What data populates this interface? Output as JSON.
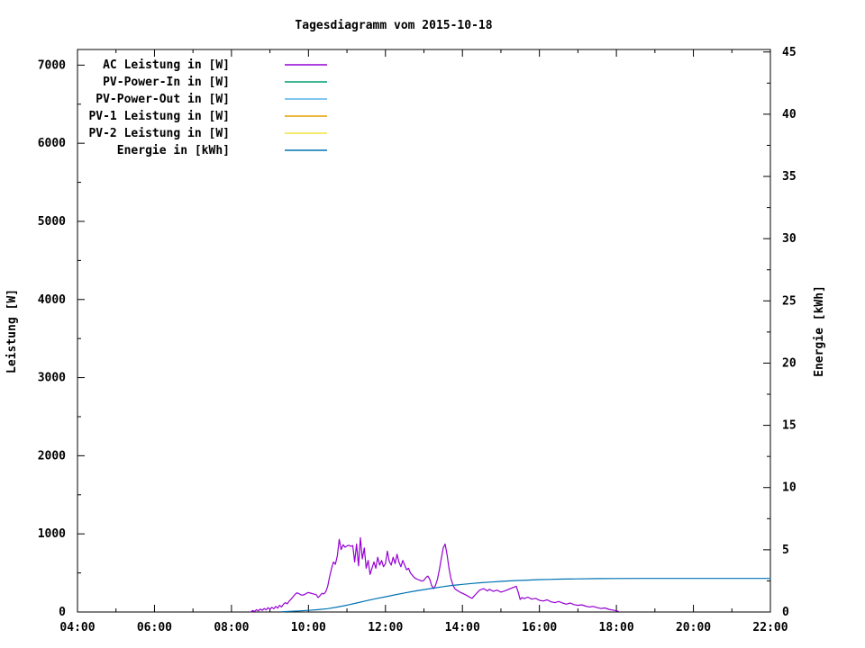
{
  "page": {
    "background": "#ffffff"
  },
  "chart_data": {
    "type": "line",
    "title": "Tagesdiagramm vom 2015-10-18",
    "legend_position": "top-left",
    "grid": false,
    "x_axis": {
      "unit": "time-of-day",
      "range_hours": [
        4,
        22
      ],
      "major_tick_hours": [
        4,
        6,
        8,
        10,
        12,
        14,
        16,
        18,
        20,
        22
      ],
      "major_tick_labels": [
        "04:00",
        "06:00",
        "08:00",
        "10:00",
        "12:00",
        "14:00",
        "16:00",
        "18:00",
        "20:00",
        "22:00"
      ],
      "minor_tick_hours": [
        5,
        7,
        9,
        11,
        13,
        15,
        17,
        19,
        21
      ]
    },
    "y_left": {
      "label": "Leistung [W]",
      "range": [
        0,
        7200
      ],
      "major_ticks": [
        0,
        1000,
        2000,
        3000,
        4000,
        5000,
        6000,
        7000
      ],
      "minor_step": 500
    },
    "y_right": {
      "label": "Energie [kWh]",
      "range": [
        0,
        45.2
      ],
      "major_ticks": [
        0,
        5,
        10,
        15,
        20,
        25,
        30,
        35,
        40,
        45
      ],
      "minor_step": 2.5
    },
    "series": [
      {
        "name": "AC Leistung in [W]",
        "color": "#9400d3",
        "axis": "left",
        "points": [
          [
            8.5,
            0
          ],
          [
            8.55,
            18
          ],
          [
            8.6,
            8
          ],
          [
            8.65,
            30
          ],
          [
            8.7,
            15
          ],
          [
            8.75,
            38
          ],
          [
            8.8,
            22
          ],
          [
            8.85,
            45
          ],
          [
            8.9,
            28
          ],
          [
            8.95,
            55
          ],
          [
            9.0,
            35
          ],
          [
            9.05,
            60
          ],
          [
            9.1,
            42
          ],
          [
            9.15,
            70
          ],
          [
            9.2,
            50
          ],
          [
            9.25,
            85
          ],
          [
            9.3,
            65
          ],
          [
            9.35,
            100
          ],
          [
            9.4,
            120
          ],
          [
            9.45,
            105
          ],
          [
            9.5,
            140
          ],
          [
            9.55,
            165
          ],
          [
            9.6,
            195
          ],
          [
            9.65,
            225
          ],
          [
            9.7,
            245
          ],
          [
            9.75,
            235
          ],
          [
            9.8,
            220
          ],
          [
            9.85,
            215
          ],
          [
            9.9,
            225
          ],
          [
            9.95,
            240
          ],
          [
            10.0,
            250
          ],
          [
            10.05,
            242
          ],
          [
            10.1,
            235
          ],
          [
            10.15,
            228
          ],
          [
            10.2,
            222
          ],
          [
            10.25,
            185
          ],
          [
            10.3,
            210
          ],
          [
            10.35,
            240
          ],
          [
            10.4,
            230
          ],
          [
            10.45,
            260
          ],
          [
            10.5,
            330
          ],
          [
            10.55,
            450
          ],
          [
            10.6,
            560
          ],
          [
            10.65,
            640
          ],
          [
            10.7,
            610
          ],
          [
            10.75,
            720
          ],
          [
            10.8,
            930
          ],
          [
            10.85,
            800
          ],
          [
            10.9,
            860
          ],
          [
            10.95,
            830
          ],
          [
            11.0,
            845
          ],
          [
            11.05,
            855
          ],
          [
            11.1,
            840
          ],
          [
            11.15,
            850
          ],
          [
            11.2,
            640
          ],
          [
            11.25,
            870
          ],
          [
            11.3,
            590
          ],
          [
            11.35,
            950
          ],
          [
            11.4,
            680
          ],
          [
            11.45,
            820
          ],
          [
            11.5,
            560
          ],
          [
            11.55,
            660
          ],
          [
            11.6,
            480
          ],
          [
            11.65,
            560
          ],
          [
            11.7,
            640
          ],
          [
            11.75,
            560
          ],
          [
            11.8,
            700
          ],
          [
            11.85,
            600
          ],
          [
            11.9,
            660
          ],
          [
            11.95,
            580
          ],
          [
            12.0,
            620
          ],
          [
            12.05,
            780
          ],
          [
            12.1,
            650
          ],
          [
            12.15,
            600
          ],
          [
            12.2,
            700
          ],
          [
            12.25,
            620
          ],
          [
            12.3,
            740
          ],
          [
            12.35,
            640
          ],
          [
            12.4,
            580
          ],
          [
            12.45,
            660
          ],
          [
            12.5,
            600
          ],
          [
            12.55,
            540
          ],
          [
            12.6,
            560
          ],
          [
            12.65,
            500
          ],
          [
            12.7,
            470
          ],
          [
            12.75,
            440
          ],
          [
            12.8,
            425
          ],
          [
            12.85,
            415
          ],
          [
            12.9,
            405
          ],
          [
            12.95,
            395
          ],
          [
            13.0,
            405
          ],
          [
            13.05,
            440
          ],
          [
            13.1,
            460
          ],
          [
            13.15,
            420
          ],
          [
            13.2,
            340
          ],
          [
            13.25,
            300
          ],
          [
            13.3,
            340
          ],
          [
            13.35,
            420
          ],
          [
            13.4,
            540
          ],
          [
            13.45,
            680
          ],
          [
            13.5,
            820
          ],
          [
            13.55,
            870
          ],
          [
            13.6,
            740
          ],
          [
            13.65,
            560
          ],
          [
            13.7,
            430
          ],
          [
            13.75,
            350
          ],
          [
            13.8,
            300
          ],
          [
            13.85,
            280
          ],
          [
            13.9,
            265
          ],
          [
            13.95,
            250
          ],
          [
            14.0,
            240
          ],
          [
            14.1,
            215
          ],
          [
            14.2,
            185
          ],
          [
            14.25,
            175
          ],
          [
            14.35,
            230
          ],
          [
            14.45,
            280
          ],
          [
            14.55,
            300
          ],
          [
            14.65,
            270
          ],
          [
            14.7,
            290
          ],
          [
            14.8,
            265
          ],
          [
            14.9,
            280
          ],
          [
            15.0,
            255
          ],
          [
            15.1,
            270
          ],
          [
            15.2,
            290
          ],
          [
            15.3,
            310
          ],
          [
            15.4,
            330
          ],
          [
            15.45,
            250
          ],
          [
            15.5,
            160
          ],
          [
            15.55,
            185
          ],
          [
            15.6,
            170
          ],
          [
            15.7,
            190
          ],
          [
            15.8,
            165
          ],
          [
            15.9,
            175
          ],
          [
            16.0,
            150
          ],
          [
            16.1,
            140
          ],
          [
            16.2,
            155
          ],
          [
            16.3,
            130
          ],
          [
            16.4,
            120
          ],
          [
            16.5,
            135
          ],
          [
            16.6,
            115
          ],
          [
            16.7,
            100
          ],
          [
            16.8,
            115
          ],
          [
            16.9,
            95
          ],
          [
            17.0,
            85
          ],
          [
            17.1,
            92
          ],
          [
            17.2,
            75
          ],
          [
            17.3,
            65
          ],
          [
            17.4,
            72
          ],
          [
            17.5,
            55
          ],
          [
            17.6,
            45
          ],
          [
            17.7,
            52
          ],
          [
            17.8,
            35
          ],
          [
            17.9,
            25
          ],
          [
            18.0,
            15
          ],
          [
            18.05,
            8
          ]
        ]
      },
      {
        "name": "PV-Power-In in [W]",
        "color": "#009e73",
        "axis": "left",
        "points": []
      },
      {
        "name": "PV-Power-Out in [W]",
        "color": "#56b4e9",
        "axis": "left",
        "points": []
      },
      {
        "name": "PV-1 Leistung in [W]",
        "color": "#e69f00",
        "axis": "left",
        "points": []
      },
      {
        "name": "PV-2 Leistung in [W]",
        "color": "#f0e442",
        "axis": "left",
        "points": []
      },
      {
        "name": "Energie in [kWh]",
        "color": "#0072b2",
        "axis": "right",
        "points": [
          [
            9.3,
            0.02
          ],
          [
            9.5,
            0.05
          ],
          [
            9.75,
            0.09
          ],
          [
            10.0,
            0.13
          ],
          [
            10.25,
            0.19
          ],
          [
            10.5,
            0.27
          ],
          [
            10.75,
            0.4
          ],
          [
            11.0,
            0.55
          ],
          [
            11.25,
            0.72
          ],
          [
            11.5,
            0.9
          ],
          [
            11.75,
            1.07
          ],
          [
            12.0,
            1.22
          ],
          [
            12.25,
            1.38
          ],
          [
            12.5,
            1.53
          ],
          [
            12.75,
            1.67
          ],
          [
            13.0,
            1.8
          ],
          [
            13.25,
            1.92
          ],
          [
            13.5,
            2.04
          ],
          [
            13.75,
            2.14
          ],
          [
            14.0,
            2.22
          ],
          [
            14.25,
            2.29
          ],
          [
            14.5,
            2.36
          ],
          [
            14.75,
            2.41
          ],
          [
            15.0,
            2.46
          ],
          [
            15.25,
            2.5
          ],
          [
            15.5,
            2.54
          ],
          [
            15.75,
            2.57
          ],
          [
            16.0,
            2.6
          ],
          [
            16.25,
            2.62
          ],
          [
            16.5,
            2.64
          ],
          [
            17.0,
            2.66
          ],
          [
            17.5,
            2.68
          ],
          [
            18.0,
            2.69
          ],
          [
            18.5,
            2.7
          ],
          [
            19.5,
            2.7
          ],
          [
            20.5,
            2.7
          ],
          [
            21.5,
            2.7
          ],
          [
            22.0,
            2.7
          ]
        ]
      }
    ]
  }
}
